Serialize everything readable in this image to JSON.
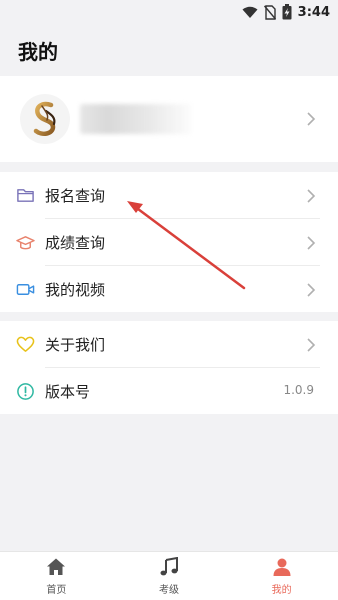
{
  "status_bar": {
    "time": "3:44"
  },
  "page": {
    "title": "我的"
  },
  "menu_group_1": [
    {
      "label": "报名查询",
      "icon": "folder-icon"
    },
    {
      "label": "成绩查询",
      "icon": "graduation-cap-icon"
    },
    {
      "label": "我的视频",
      "icon": "video-camera-icon"
    }
  ],
  "menu_group_2": [
    {
      "label": "关于我们",
      "icon": "heart-icon"
    },
    {
      "label": "版本号",
      "icon": "info-icon",
      "value": "1.0.9"
    }
  ],
  "tabs": [
    {
      "label": "首页",
      "icon": "home-icon"
    },
    {
      "label": "考级",
      "icon": "music-note-icon"
    },
    {
      "label": "我的",
      "icon": "person-icon",
      "active": true
    }
  ],
  "colors": {
    "accent": "#e8695a",
    "folder_icon": "#7a73b8",
    "cap_icon": "#e8826c",
    "video_icon": "#3a8fe0",
    "heart_icon": "#e8c21a",
    "info_icon": "#2fb8a2",
    "annotation_arrow": "#d9403a"
  }
}
